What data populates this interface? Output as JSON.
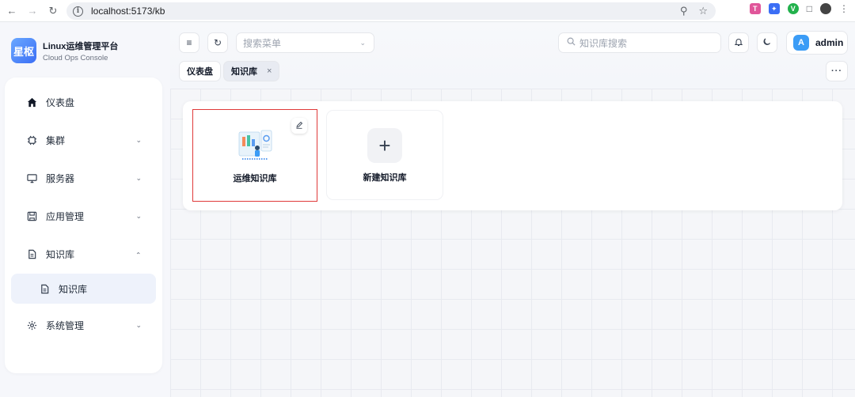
{
  "browser": {
    "url": "localhost:5173/kb"
  },
  "sidebar": {
    "brand_logo": "星枢",
    "brand_title": "Linux运维管理平台",
    "brand_subtitle": "Cloud Ops Console",
    "items": [
      {
        "label": "仪表盘",
        "icon": "home-icon"
      },
      {
        "label": "集群",
        "icon": "chip-icon",
        "expanded": false
      },
      {
        "label": "服务器",
        "icon": "monitor-icon",
        "expanded": false
      },
      {
        "label": "应用管理",
        "icon": "save-icon",
        "expanded": false
      },
      {
        "label": "知识库",
        "icon": "document-icon",
        "expanded": true
      },
      {
        "label": "知识库",
        "icon": "document-icon",
        "active": true
      },
      {
        "label": "系统管理",
        "icon": "gear-icon",
        "expanded": false
      }
    ]
  },
  "header": {
    "menu_search_placeholder": "搜索菜单",
    "kb_search_placeholder": "知识库搜索",
    "user_initial": "A",
    "user_name": "admin"
  },
  "tabs": [
    {
      "label": "仪表盘",
      "active": false
    },
    {
      "label": "知识库",
      "active": true,
      "close": "×"
    }
  ],
  "main": {
    "kb_cards": [
      {
        "title": "运维知识库"
      }
    ],
    "new_card_title": "新建知识库",
    "new_card_icon": "+"
  },
  "colors": {
    "accent": "#3b6ef5",
    "selection_border": "#e03a3a",
    "avatar": "#3b9cf6"
  }
}
